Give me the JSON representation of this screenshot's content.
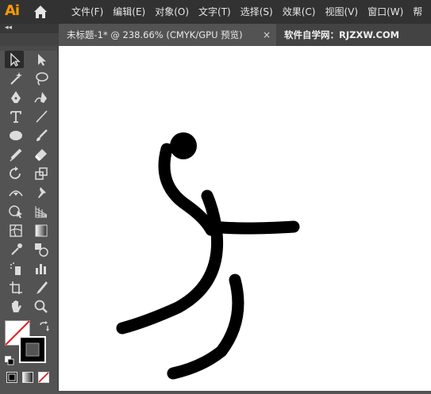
{
  "app": {
    "logo_text": "Ai"
  },
  "menu": {
    "items": [
      "文件(F)",
      "编辑(E)",
      "对象(O)",
      "文字(T)",
      "选择(S)",
      "效果(C)",
      "视图(V)",
      "窗口(W)",
      "帮"
    ]
  },
  "tabs": {
    "active_label": "未标题-1* @ 238.66% (CMYK/GPU 预览)",
    "close_glyph": "×",
    "other_label": "软件自学网：RJZXW.COM"
  },
  "panel": {
    "collapse_glyph": "◂◂"
  },
  "toolbar": {
    "tools": [
      "selection-tool",
      "direct-selection-tool",
      "magic-wand-tool",
      "lasso-tool",
      "pen-tool",
      "curvature-tool",
      "type-tool",
      "line-segment-tool",
      "ellipse-tool",
      "paintbrush-tool",
      "shaper-tool",
      "eraser-tool",
      "rotate-tool",
      "scale-tool",
      "width-tool",
      "puppet-warp-tool",
      "shape-builder-tool",
      "perspective-grid-tool",
      "mesh-tool",
      "gradient-tool",
      "eyedropper-tool",
      "blend-tool",
      "symbol-sprayer-tool",
      "column-graph-tool",
      "artboard-tool",
      "slice-tool",
      "hand-tool",
      "zoom-tool"
    ],
    "fill_color": "#ffffff",
    "stroke_color": "#000000"
  },
  "colors": {
    "menubar_bg": "#323232",
    "ui_bg": "#535353",
    "accent_logo": "#ff9a00",
    "canvas_bg": "#ffffff",
    "artwork_stroke": "#000000"
  }
}
